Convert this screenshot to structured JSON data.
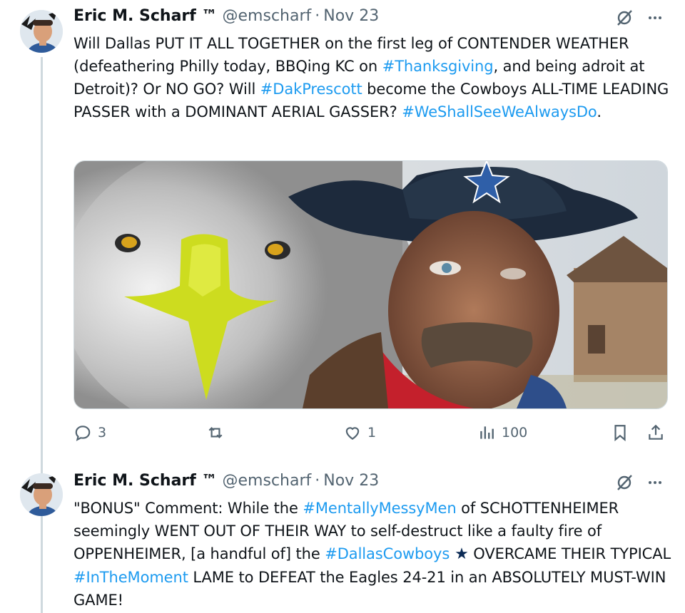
{
  "tweets": [
    {
      "author_name": "Eric M. Scharf ™",
      "handle": "@emscharf",
      "separator": "·",
      "date": "Nov 23",
      "text_parts": {
        "p1": "Will Dallas PUT IT ALL TOGETHER on the first leg of CONTENDER WEATHER (defeathering Philly today, BBQing KC on ",
        "h1": "#Thanksgiving",
        "p2": ", and being adroit at Detroit)? Or NO GO? Will ",
        "h2": "#DakPrescott",
        "p3": " become the Cowboys ALL-TIME LEADING PASSER with a DOMINANT AERIAL GASSER? ",
        "h3": "#WeShallSeeWeAlwaysDo",
        "p4": "."
      },
      "stats": {
        "replies": "3",
        "reposts": "",
        "likes": "1",
        "views": "100"
      }
    },
    {
      "author_name": "Eric M. Scharf ™",
      "handle": "@emscharf",
      "separator": "·",
      "date": "Nov 23",
      "text_parts": {
        "p1": "\"BONUS\" Comment: While the ",
        "h1": "#MentallyMessyMen",
        "p2": " of SCHOTTENHEIMER seemingly WENT OUT OF THEIR WAY to self-destruct like a faulty fire of OPPENHEIMER, [a handful of] the ",
        "h2": "#DallasCowboys",
        "p3": " OVERCAME THEIR TYPICAL ",
        "h3": "#InTheMoment",
        "p4": " LAME to DEFEAT the Eagles 24-21 in an ABSOLUTELY MUST-WIN GAME!"
      }
    }
  ],
  "icons": {
    "grok": "grok-icon",
    "more": "more-icon",
    "reply": "reply-icon",
    "repost": "repost-icon",
    "like": "like-icon",
    "views": "views-icon",
    "bookmark": "bookmark-icon",
    "share": "share-icon",
    "cowboys_star": "cowboys-star-emoji"
  },
  "colors": {
    "text": "#0f1419",
    "secondary": "#536471",
    "link": "#1d9bf0",
    "border": "#cfd9de"
  }
}
